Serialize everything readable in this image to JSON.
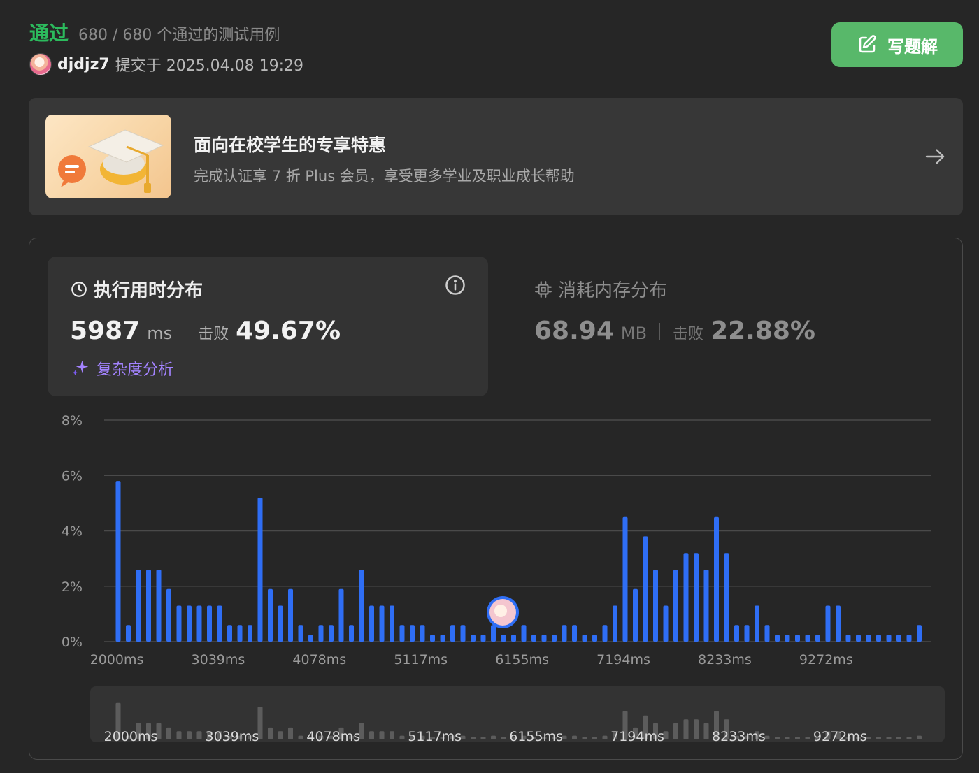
{
  "header": {
    "status": "通过",
    "test_cases": "680 / 680 个通过的测试用例",
    "username": "djdjz7",
    "submit_text": "提交于 2025.04.08 19:29",
    "write_solution_label": "写题解"
  },
  "promo": {
    "title": "面向在校学生的专享特惠",
    "subtitle": "完成认证享 7 折 Plus 会员，享受更多学业及职业成长帮助"
  },
  "runtime": {
    "title": "执行用时分布",
    "value": "5987",
    "unit": "ms",
    "beats_label": "击败",
    "beats_pct": "49.67%",
    "analysis_label": "复杂度分析"
  },
  "memory": {
    "title": "消耗内存分布",
    "value": "68.94",
    "unit": "MB",
    "beats_label": "击败",
    "beats_pct": "22.88%"
  },
  "colors": {
    "accepted": "#2cbb5d",
    "button": "#58b86a",
    "bar": "#2f6ef5",
    "analysis": "#a383ff"
  },
  "chart_data": {
    "type": "bar",
    "title": "",
    "xlabel": "",
    "ylabel": "",
    "ylim": [
      0,
      8
    ],
    "yticks": [
      "0%",
      "2%",
      "4%",
      "6%",
      "8%"
    ],
    "xticks": [
      "2000ms",
      "3039ms",
      "4078ms",
      "5117ms",
      "6155ms",
      "7194ms",
      "8233ms",
      "9272ms"
    ],
    "grid": true,
    "highlight_value": "5987 ms",
    "values": [
      5.8,
      0.6,
      2.6,
      2.6,
      2.6,
      1.9,
      1.3,
      1.3,
      1.3,
      1.3,
      1.3,
      0.6,
      0.6,
      0.6,
      5.2,
      1.9,
      1.3,
      1.9,
      0.6,
      0.25,
      0.6,
      0.6,
      1.9,
      0.6,
      2.6,
      1.3,
      1.3,
      1.3,
      0.6,
      0.6,
      0.6,
      0.25,
      0.25,
      0.6,
      0.6,
      0.25,
      0.25,
      0.6,
      0.25,
      0.25,
      0.6,
      0.25,
      0.25,
      0.25,
      0.6,
      0.6,
      0.25,
      0.25,
      0.6,
      1.3,
      4.5,
      1.9,
      3.8,
      2.6,
      1.3,
      2.6,
      3.2,
      3.2,
      2.6,
      4.5,
      3.2,
      0.6,
      0.6,
      1.3,
      0.6,
      0.25,
      0.25,
      0.25,
      0.25,
      0.25,
      1.3,
      1.3,
      0.25,
      0.25,
      0.25,
      0.25,
      0.25,
      0.25,
      0.25,
      0.6
    ]
  }
}
